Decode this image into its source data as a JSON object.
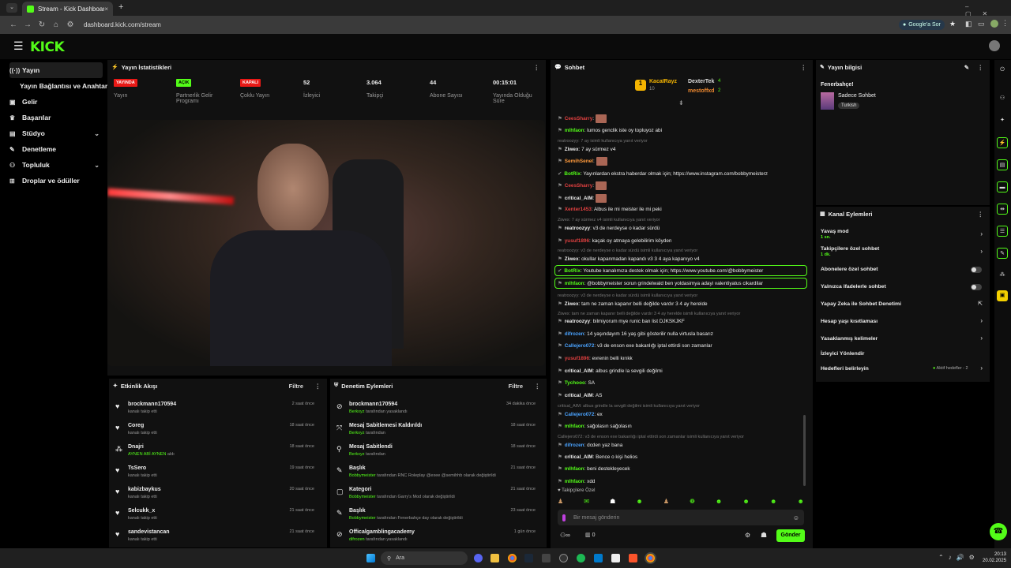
{
  "browser": {
    "tab_title": "Stream - Kick Dashboard",
    "url": "dashboard.kick.com/stream",
    "google_sor": "Google'a Sor"
  },
  "brand": {
    "logo": "KICK",
    "accent": "#53fc18"
  },
  "sidebar": {
    "items": [
      {
        "label": "Yayın",
        "icon": "broadcast-icon",
        "active": true
      },
      {
        "label": "Yayın Bağlantısı ve Anahtarı",
        "icon": ""
      },
      {
        "label": "Gelir",
        "icon": "wallet-icon"
      },
      {
        "label": "Başarılar",
        "icon": "trophy-icon"
      },
      {
        "label": "Stüdyo",
        "icon": "studio-icon",
        "expandable": true
      },
      {
        "label": "Denetleme",
        "icon": "wrench-icon"
      },
      {
        "label": "Topluluk",
        "icon": "community-icon",
        "expandable": true
      },
      {
        "label": "Droplar ve ödüller",
        "icon": "gift-icon"
      }
    ]
  },
  "stats": {
    "title": "Yayın İstatistikleri",
    "items": [
      {
        "value": "YAYINDA",
        "label": "Yayın",
        "badge": "red"
      },
      {
        "value": "AÇIK",
        "label": "Partnerlik Gelir Programı",
        "badge": "green"
      },
      {
        "value": "KAPALI",
        "label": "Çoklu Yayın",
        "badge": "red"
      },
      {
        "value": "52",
        "label": "İzleyici"
      },
      {
        "value": "3.064",
        "label": "Takipçi"
      },
      {
        "value": "44",
        "label": "Abone Sayısı"
      },
      {
        "value": "00:15:01",
        "label": "Yayında Olduğu Süre"
      }
    ]
  },
  "activity": {
    "title": "Etkinlik Akışı",
    "filter": "Filtre",
    "rows": [
      {
        "name": "brockmann170594",
        "sub": "kanalı takip etti",
        "time": "2 saat önce",
        "icon": "heart-icon"
      },
      {
        "name": "Coreg",
        "sub": "kanalı takip etti",
        "time": "18 saat önce",
        "icon": "heart-icon"
      },
      {
        "name": "Dnajri",
        "sub_green": "AYNEN ABİ AYNEN",
        "sub": " aldı",
        "time": "18 saat önce",
        "icon": "reward-icon"
      },
      {
        "name": "TsSero",
        "sub": "kanalı takip etti",
        "time": "19 saat önce",
        "icon": "heart-icon"
      },
      {
        "name": "kabizbaykus",
        "sub": "kanalı takip etti",
        "time": "20 saat önce",
        "icon": "heart-icon"
      },
      {
        "name": "Selcukk_x",
        "sub": "kanalı takip etti",
        "time": "21 saat önce",
        "icon": "heart-icon"
      },
      {
        "name": "sandevistancan",
        "sub": "kanalı takip etti",
        "time": "21 saat önce",
        "icon": "heart-icon"
      }
    ]
  },
  "moderation": {
    "title": "Denetim Eylemleri",
    "filter": "Filtre",
    "rows": [
      {
        "name": "brockmann170594",
        "who": "Berkxyz",
        "sub": " tarafından yasaklandı",
        "time": "34 dakika önce",
        "icon": "ban-icon"
      },
      {
        "name": "Mesaj Sabitlemesi Kaldırıldı",
        "who": "Berkxyz",
        "sub": " tarafından",
        "time": "18 saat önce",
        "icon": "unpin-icon"
      },
      {
        "name": "Mesaj Sabitlendi",
        "who": "Berkxyz",
        "sub": " tarafından",
        "time": "18 saat önce",
        "icon": "pin-icon"
      },
      {
        "name": "Başlık",
        "who": "Bobbymeister",
        "sub": " tarafından RNC Roleplay @exee @semihhb olarak değiştirildi",
        "time": "21 saat önce",
        "icon": "edit-icon"
      },
      {
        "name": "Kategori",
        "who": "Bobbymeister",
        "sub": " tarafından Garry's Mod olarak değiştirildi",
        "time": "21 saat önce",
        "icon": "category-icon"
      },
      {
        "name": "Başlık",
        "who": "Bobbymeister",
        "sub": " tarafından Fenerbahçe day olarak değiştirildi",
        "time": "23 saat önce",
        "icon": "edit-icon"
      },
      {
        "name": "Officalgamblingacademy",
        "who": "difrozen",
        "sub": " tarafından yasaklandı",
        "time": "1 gün önce",
        "icon": "ban-icon"
      }
    ]
  },
  "chat": {
    "title": "Sohbet",
    "top_gifters": [
      {
        "name": "KacaIRayz",
        "count": "10"
      },
      {
        "name": "DexterTek",
        "count": "4"
      },
      {
        "name": "mestoffxd",
        "count": "2"
      }
    ],
    "messages": [
      {
        "user": "CeesSharry",
        "text": "",
        "color": "#e04040"
      },
      {
        "user": "mlhfaon",
        "text": "lumos genclik iste oy topluyoz abi",
        "color": "#53fc18"
      },
      {
        "reply": "reatroozyy: 7 ay isimli kullanıcıya yanıt veriyor"
      },
      {
        "user": "Ziwex",
        "text": "7 ay sürmez v4",
        "color": "#eee"
      },
      {
        "user": "SemihSenel",
        "text": "",
        "color": "#ff9a3c"
      },
      {
        "user": "BotRix",
        "text": "Yayınlardan ekstra haberdar olmak için; https://www.instagram.com/bobbymeisterz",
        "color": "#53fc18"
      },
      {
        "user": "CeesSharry",
        "text": "",
        "color": "#e04040"
      },
      {
        "user": "critical_AIM",
        "text": "",
        "color": "#eee"
      },
      {
        "user": "Xenter1453",
        "text": "Albus ile mi meister ile mi peki",
        "color": "#e04040"
      },
      {
        "reply": "Ziwex: 7 ay sürmez v4 isimli kullanıcıya yanıt veriyor"
      },
      {
        "user": "reatroozyy",
        "text": "v3 de nerdeyse o kadar sürdü",
        "color": "#eee"
      },
      {
        "user": "yusuf1896",
        "text": "kaçak oy atmaya gelebilirim köyden",
        "color": "#e04040"
      },
      {
        "reply": "reatroozyy: v3 de nerdeyse o kadar sürdü isimli kullanıcıya yanıt veriyor"
      },
      {
        "user": "Ziwex",
        "text": "okullar kapanmadan kapandı v3 3 4 aya kapanıyo v4",
        "color": "#eee"
      },
      {
        "user": "BotRix",
        "text": "Youtube kanalımıza destek olmak için; https://www.youtube.com/@bobbymeister",
        "color": "#53fc18",
        "highlight": true
      },
      {
        "user": "mlhfaon",
        "text": "@bobbymeister sorun grindelwald ben yoldasimya adayi valentiyatus cikardilar",
        "color": "#53fc18",
        "highlight": true
      },
      {
        "reply": "reatroozyy: v3 de nerdeyse o kadar sürdü isimli kullanıcıya yanıt veriyor"
      },
      {
        "user": "Ziwex",
        "text": "tam ne zaman kapanır belli değilde vardır 3 4 ay herelde",
        "color": "#eee"
      },
      {
        "reply": "Ziwex: tam ne zaman kapanır belli değilde vardır 3 4 ay herelde isimli kullanıcıya yanıt veriyor"
      },
      {
        "user": "reatroozyy",
        "text": "bilmiyorum mye runic ban list DJKSKJKF",
        "color": "#eee"
      },
      {
        "user": "difrozen",
        "text": "14 yaşındayım 16 yaş gibi gösterilir nulla virtusla basarız",
        "color": "#4aa3ff"
      },
      {
        "user": "Callejero072",
        "text": "v3 de enson exe bakanlığı iptal ettirdi son zamanlar",
        "color": "#4aa3ff"
      },
      {
        "user": "yusuf1896",
        "text": "evrenin belli kırıkk",
        "color": "#e04040"
      },
      {
        "user": "critical_AIM",
        "text": "albus grindle la sevgili değilmi",
        "color": "#eee"
      },
      {
        "user": "Tychooo",
        "text": "SA",
        "color": "#53fc18"
      },
      {
        "user": "critical_AIM",
        "text": "AS",
        "color": "#eee"
      },
      {
        "reply": "critical_AIM: albus grindle la sevgili değilmi isimli kullanıcıya yanıt veriyor"
      },
      {
        "user": "Callejero072",
        "text": "ex",
        "color": "#4aa3ff"
      },
      {
        "user": "mlhfaon",
        "text": "sağolasın sağolasın",
        "color": "#53fc18"
      },
      {
        "reply": "Callejero072: v3 de enson exe bakanlığı iptal ettirdi son zamanlar isimli kullanıcıya yanıt veriyor"
      },
      {
        "user": "difrozen",
        "text": "dcden yaz bana",
        "color": "#4aa3ff"
      },
      {
        "user": "critical_AIM",
        "text": "Bence o kişi helios",
        "color": "#eee"
      },
      {
        "user": "mlhfaon",
        "text": "beni destekleyecek",
        "color": "#53fc18"
      },
      {
        "user": "mlhfaon",
        "text": "xdd",
        "color": "#53fc18"
      }
    ],
    "followers_only": "Takipçilere Özel",
    "input_placeholder": "Bir mesaj gönderin",
    "viewers": "0",
    "send_label": "Gönder"
  },
  "stream_info": {
    "title": "Yayın bilgisi",
    "stream_title": "Fenerbahçe!",
    "category": "Sadece Sohbet",
    "tag": "Turkish"
  },
  "channel_actions": {
    "title": "Kanal Eylemleri",
    "items": [
      {
        "label": "Yavaş mod",
        "sub": "1 sn.",
        "control": "chevron"
      },
      {
        "label": "Takipçilere özel sohbet",
        "sub": "1 dk.",
        "control": "chevron"
      },
      {
        "label": "Abonelere özel sohbet",
        "control": "toggle"
      },
      {
        "label": "Yalnızca ifadelerle sohbet",
        "control": "toggle"
      },
      {
        "label": "Yapay Zeka ile Sohbet Denetimi",
        "control": "external"
      },
      {
        "label": "Hesap yaşı kısıtlaması",
        "control": "chevron"
      },
      {
        "label": "Yasaklanmış kelimeler",
        "control": "chevron"
      },
      {
        "label": "İzleyici Yönlendir",
        "control": "none"
      },
      {
        "label": "Hedefleri belirleyin",
        "control": "chevron",
        "right": "Aktif hedefler - 2"
      }
    ]
  },
  "taskbar": {
    "search": "Ara",
    "time": "20:13",
    "date": "20.02.2025"
  }
}
